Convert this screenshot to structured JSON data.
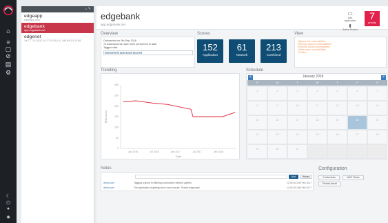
{
  "icons": {
    "logo": "swirl-logo-icon",
    "nav": [
      "home-icon",
      "list-icon",
      "chat-icon",
      "ban-icon",
      "report-icon",
      "settings-icon"
    ],
    "bottom": [
      "moon-icon",
      "power-icon",
      "user-icon",
      "gear-icon"
    ]
  },
  "apps": {
    "toolbar_text": "⌂  ✎",
    "items": [
      {
        "name": "edgeapp",
        "sub": "edgeapp.com",
        "selected": false
      },
      {
        "name": "edgebank",
        "sub": "app.edgebank.net",
        "selected": true
      },
      {
        "name": "edgenet",
        "sub": "1a:77, 23.24.57.10.27.0.0.8.6.4, 186.88.10.10.68",
        "selected": false
      }
    ]
  },
  "header": {
    "title": "edgebank",
    "subtitle": "app.edgebank.net",
    "app_action_label": "Add application",
    "app_action_sub": "Active Protect",
    "priority_value": "7",
    "priority_label": "priority"
  },
  "overview": {
    "title": "Overview",
    "line1": "Onboarded on 9th Sep 2018",
    "line2": "74 assessments have been performed to date.",
    "line3": "Tagged with:",
    "tags": [
      "CVSS score",
      "PCI",
      "SOX",
      "HIPAA"
    ]
  },
  "scores": {
    "title": "Scores",
    "items": [
      {
        "value": "152",
        "label": "Application"
      },
      {
        "value": "61",
        "label": "Network"
      },
      {
        "value": "213",
        "label": "Combined"
      }
    ]
  },
  "view": {
    "title": "View",
    "lines": [
      "Highest risk vulnerabilities",
      "Recently opened vulnerabilities",
      "Recently closed vulnerabilities",
      "Oldest open vulnerabilities",
      "Timeline"
    ]
  },
  "trend": {
    "title": "Trending",
    "y_label": "Risk score",
    "x_label": "Date"
  },
  "chart_data": {
    "type": "line",
    "title": "Trending",
    "ylabel": "Risk score",
    "xlabel": "Date",
    "x": [
      "Jan 2016",
      "Jul 2016",
      "Jan 2017",
      "Jul 2017",
      "Jan 2018"
    ],
    "y_ticks": [
      0,
      50,
      100,
      150,
      200,
      250,
      300
    ],
    "series": [
      {
        "values": [
          {
            "x": "Jan 2016",
            "y": 220
          },
          {
            "x": "Mar 2016",
            "y": 225
          },
          {
            "x": "Jul 2016",
            "y": 214
          },
          {
            "x": "Sep 2016",
            "y": 208
          },
          {
            "x": "Jan 2017",
            "y": 185
          },
          {
            "x": "Jan 2017 end",
            "y": 150
          },
          {
            "x": "Jul 2017",
            "y": 150
          },
          {
            "x": "Jan 2018",
            "y": 170
          }
        ]
      }
    ],
    "ylim": [
      0,
      300
    ],
    "grid": false
  },
  "schedule": {
    "title": "Schedule",
    "month": "January 2018",
    "prev": "<",
    "next": ">",
    "days": [
      "S",
      "M",
      "T",
      "W",
      "T",
      "F",
      "S"
    ],
    "weeks": [
      [
        "1",
        "2",
        "3",
        "4",
        "5",
        "6",
        "7"
      ],
      [
        "8",
        "9",
        "10",
        "11",
        "12",
        "13",
        "14"
      ],
      [
        "15",
        "16",
        "17",
        "18",
        "19",
        "20",
        "21"
      ],
      [
        "22",
        "23",
        "24",
        "25",
        "26",
        "27",
        "28"
      ],
      [
        "29",
        "30",
        "31",
        "",
        "",
        "",
        ""
      ]
    ],
    "today_index": 19,
    "today_label": "18"
  },
  "notes": {
    "title": "Notes",
    "add_label": "Add",
    "history_label": "History",
    "rows": [
      {
        "user": "demo.user",
        "text": "Tagging a ghost for filtering constructive deleted queries",
        "time": "12:04:45 24th Feb 2017"
      },
      {
        "user": "demo.user",
        "text": "The application is getting much more secure. Thanks edgescan!",
        "time": "12:04:29 24th Feb 2017"
      }
    ]
  },
  "config": {
    "title": "Configuration",
    "buttons": [
      "Credentials",
      "WAF Rules",
      "Retest Asset"
    ]
  }
}
